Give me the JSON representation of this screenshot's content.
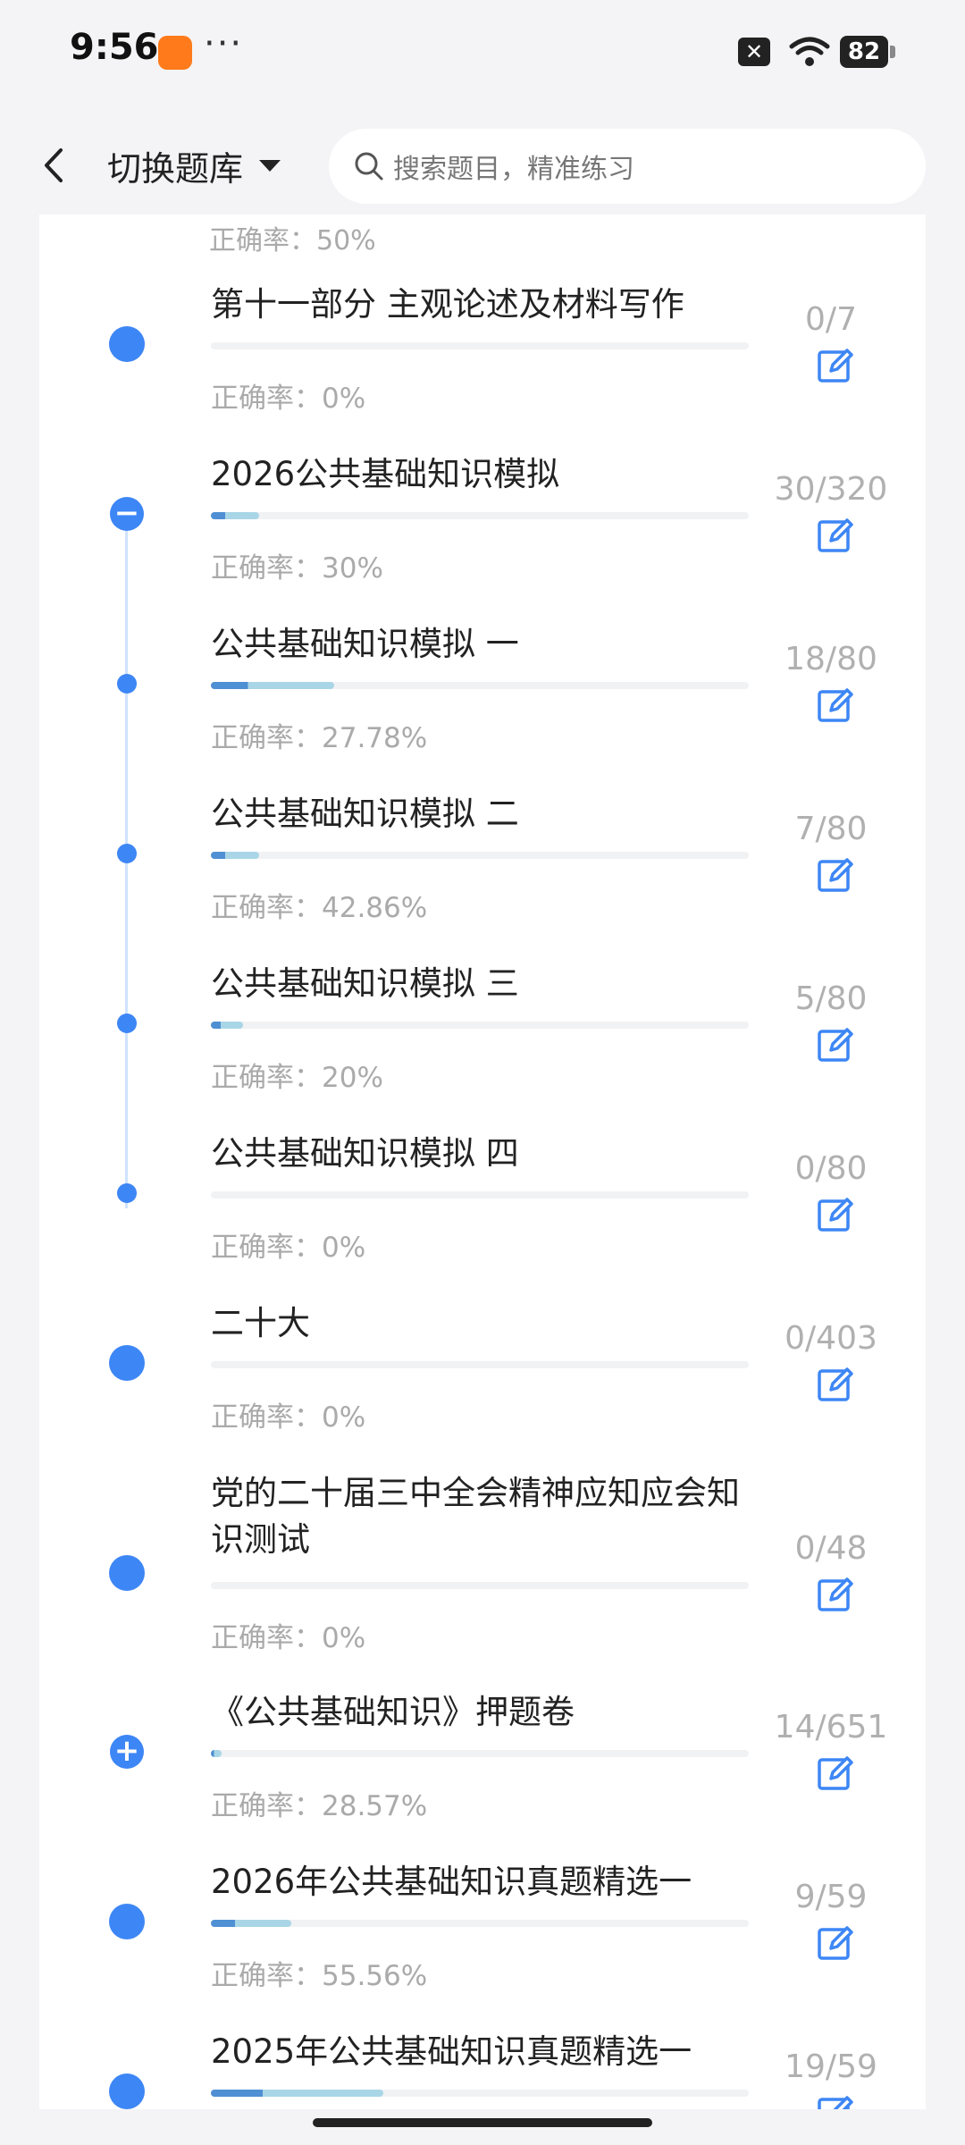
{
  "status_bar": {
    "time": "9:56",
    "dots": "···",
    "battery": "82"
  },
  "header": {
    "back_icon": "chevron-left-icon",
    "switch_label": "切换题库",
    "search_placeholder": "搜索题目，精准练习"
  },
  "partial_rate": "正确率：50%",
  "items": [
    {
      "title": "第十一部分 主观论述及材料写作",
      "rate": "正确率：0%",
      "count": "0/7",
      "progress": 0.0,
      "marker": "dot"
    },
    {
      "title": "2026公共基础知识模拟",
      "rate": "正确率：30%",
      "count": "30/320",
      "progress": 0.09,
      "marker": "minus"
    },
    {
      "title": "公共基础知识模拟 一",
      "rate": "正确率：27.78%",
      "count": "18/80",
      "progress": 0.23,
      "marker": "small"
    },
    {
      "title": "公共基础知识模拟 二",
      "rate": "正确率：42.86%",
      "count": "7/80",
      "progress": 0.09,
      "marker": "small"
    },
    {
      "title": "公共基础知识模拟 三",
      "rate": "正确率：20%",
      "count": "5/80",
      "progress": 0.06,
      "marker": "small"
    },
    {
      "title": "公共基础知识模拟 四",
      "rate": "正确率：0%",
      "count": "0/80",
      "progress": 0.0,
      "marker": "small"
    },
    {
      "title": "二十大",
      "rate": "正确率：0%",
      "count": "0/403",
      "progress": 0.0,
      "marker": "dot"
    },
    {
      "title": "党的二十届三中全会精神应知应会知识测试",
      "rate": "正确率：0%",
      "count": "0/48",
      "progress": 0.0,
      "marker": "dot"
    },
    {
      "title": "《公共基础知识》押题卷",
      "rate": "正确率：28.57%",
      "count": "14/651",
      "progress": 0.02,
      "marker": "plus"
    },
    {
      "title": "2026年公共基础知识真题精选一",
      "rate": "正确率：55.56%",
      "count": "9/59",
      "progress": 0.15,
      "marker": "dot"
    },
    {
      "title": "2025年公共基础知识真题精选一",
      "rate": "",
      "count": "19/59",
      "progress": 0.32,
      "marker": "dot"
    }
  ]
}
